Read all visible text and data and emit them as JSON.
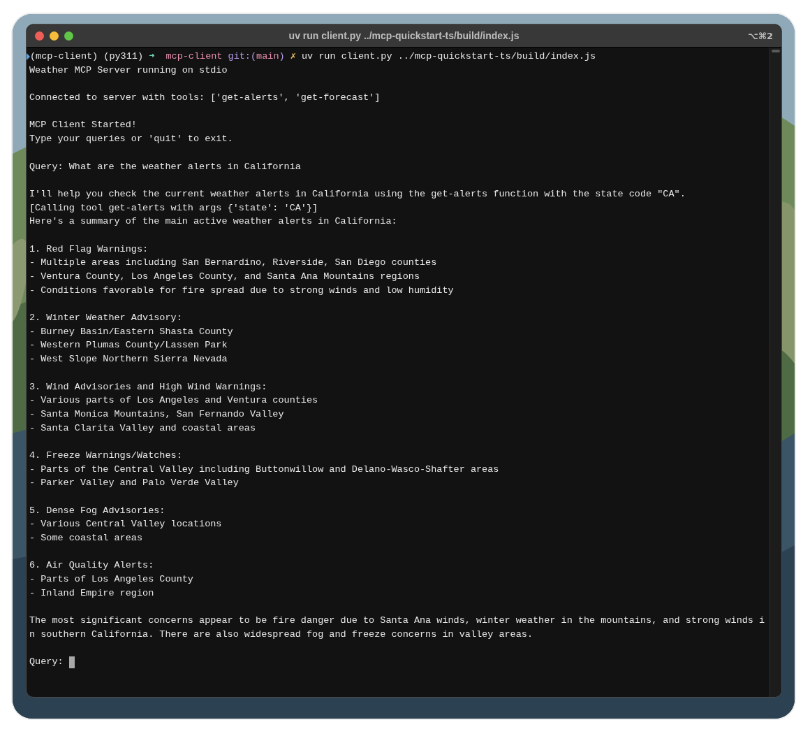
{
  "window": {
    "title": "uv run client.py ../mcp-quickstart-ts/build/index.js",
    "shortcut": "⌥⌘2"
  },
  "prompt": {
    "env": "(mcp-client) (py311)",
    "arrow": "➜",
    "dir": "mcp-client",
    "git_open": "git:(",
    "branch": "main",
    "git_close": ")",
    "dirty": "✗",
    "command": "uv run client.py ../mcp-quickstart-ts/build/index.js"
  },
  "blocks": [
    [
      "Weather MCP Server running on stdio"
    ],
    [
      "Connected to server with tools: ['get-alerts', 'get-forecast']"
    ],
    [
      "MCP Client Started!",
      "Type your queries or 'quit' to exit."
    ],
    [
      "Query: What are the weather alerts in California"
    ],
    [
      "I'll help you check the current weather alerts in California using the get-alerts function with the state code \"CA\".",
      "[Calling tool get-alerts with args {'state': 'CA'}]",
      "Here's a summary of the main active weather alerts in California:"
    ],
    [
      "1. Red Flag Warnings:",
      "- Multiple areas including San Bernardino, Riverside, San Diego counties",
      "- Ventura County, Los Angeles County, and Santa Ana Mountains regions",
      "- Conditions favorable for fire spread due to strong winds and low humidity"
    ],
    [
      "2. Winter Weather Advisory:",
      "- Burney Basin/Eastern Shasta County",
      "- Western Plumas County/Lassen Park",
      "- West Slope Northern Sierra Nevada"
    ],
    [
      "3. Wind Advisories and High Wind Warnings:",
      "- Various parts of Los Angeles and Ventura counties",
      "- Santa Monica Mountains, San Fernando Valley",
      "- Santa Clarita Valley and coastal areas"
    ],
    [
      "4. Freeze Warnings/Watches:",
      "- Parts of the Central Valley including Buttonwillow and Delano-Wasco-Shafter areas",
      "- Parker Valley and Palo Verde Valley"
    ],
    [
      "5. Dense Fog Advisories:",
      "- Various Central Valley locations",
      "- Some coastal areas"
    ],
    [
      "6. Air Quality Alerts:",
      "- Parts of Los Angeles County",
      "- Inland Empire region"
    ],
    [
      "The most significant concerns appear to be fire danger due to Santa Ana winds, winter weather in the mountains, and strong winds i",
      "n southern California. There are also widespread fog and freeze concerns in valley areas."
    ]
  ],
  "input": {
    "label": "Query:"
  }
}
